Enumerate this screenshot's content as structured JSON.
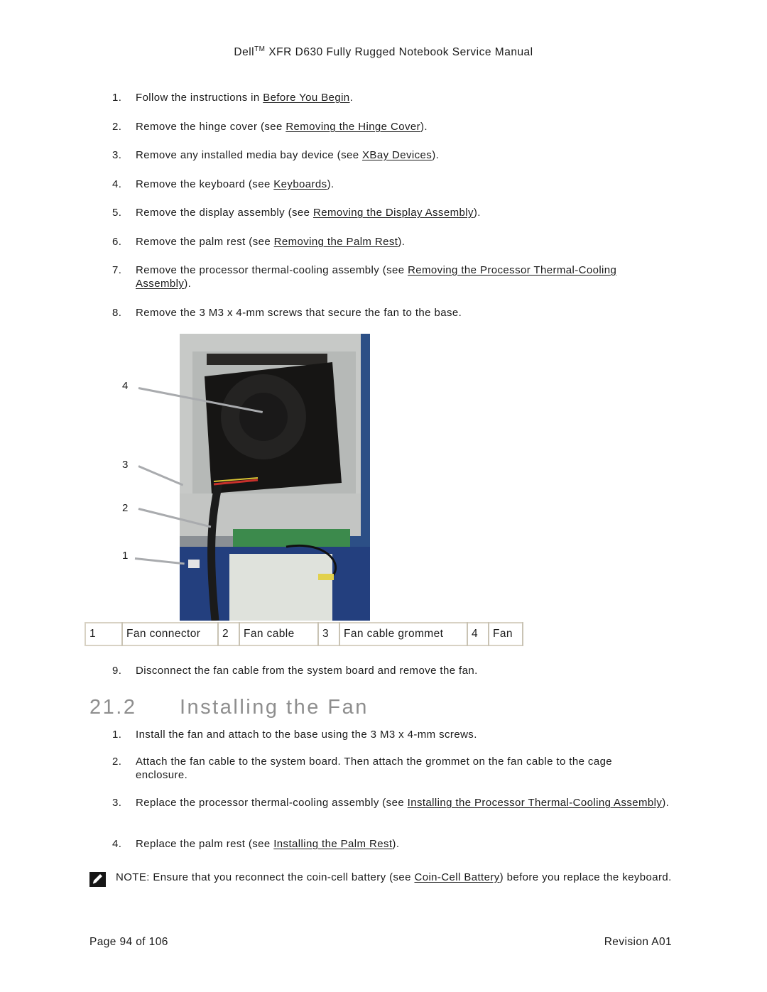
{
  "header": {
    "brand": "Dell",
    "trademark": "TM",
    "title_rest": " XFR D630 Fully Rugged Notebook Service Manual"
  },
  "removal_steps": [
    {
      "num": "1.",
      "pre": "Follow the instructions in ",
      "link": "Before You Begin",
      "post": "."
    },
    {
      "num": "2.",
      "pre": "Remove the hinge cover (see ",
      "link": "Removing the Hinge Cover",
      "post": ")."
    },
    {
      "num": "3.",
      "pre": "Remove any installed media bay device (see ",
      "link": "XBay Devices",
      "post": ")."
    },
    {
      "num": "4.",
      "pre": "Remove the keyboard (see ",
      "link": "Keyboards",
      "post": ")."
    },
    {
      "num": "5.",
      "pre": "Remove the display assembly (see ",
      "link": "Removing the Display Assembly",
      "post": ")."
    },
    {
      "num": "6.",
      "pre": "Remove the palm rest (see ",
      "link": "Removing the Palm Rest",
      "post": ")."
    },
    {
      "num": "7.",
      "pre": "Remove the processor thermal-cooling assembly (see ",
      "link": "Removing the Processor Thermal-Cooling Assembly",
      "post": ")."
    },
    {
      "num": "8.",
      "pre": "Remove the 3 M3 x 4-mm screws that secure the fan to the base.",
      "link": "",
      "post": ""
    },
    {
      "num": "9.",
      "pre": "Disconnect the fan cable from the system board and remove the fan.",
      "link": "",
      "post": ""
    }
  ],
  "figure": {
    "description": "Photo of notebook base showing the fan, fan cable, grommet and connector",
    "callouts": [
      "4",
      "3",
      "2",
      "1"
    ]
  },
  "legend": [
    {
      "num": "1",
      "label": "Fan connector"
    },
    {
      "num": "2",
      "label": "Fan cable"
    },
    {
      "num": "3",
      "label": "Fan cable grommet"
    },
    {
      "num": "4",
      "label": "Fan"
    }
  ],
  "section": {
    "number": "21.2",
    "title": "Installing the Fan"
  },
  "install_steps": [
    {
      "num": "1.",
      "pre": "Install the fan and attach to the base using the 3 M3 x 4-mm screws.",
      "link": "",
      "post": ""
    },
    {
      "num": "2.",
      "pre": "Attach the fan cable to the system board.  Then attach the grommet on the fan cable to the cage enclosure.",
      "link": "",
      "post": ""
    },
    {
      "num": "3.",
      "pre": "Replace the processor thermal-cooling assembly (see ",
      "link": "Installing the Processor Thermal-Cooling Assembly",
      "post": ")."
    },
    {
      "num": "4.",
      "pre": "Replace the palm rest (see ",
      "link": "Installing the Palm Rest",
      "post": ")."
    }
  ],
  "note": {
    "icon": "note-pencil-icon",
    "pre": "NOTE: Ensure that you reconnect the coin-cell battery (see ",
    "link": "Coin-Cell Battery",
    "post": ") before you replace the keyboard."
  },
  "footer": {
    "page": "Page 94 of 106",
    "revision": "Revision A01"
  }
}
